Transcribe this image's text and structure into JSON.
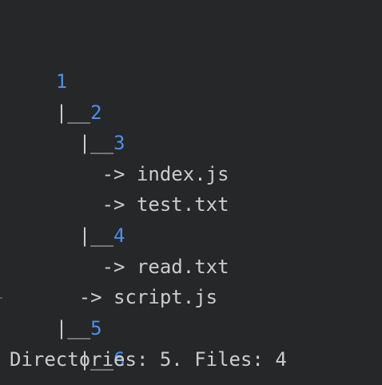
{
  "console": {
    "lines": [
      {
        "kind": "dir",
        "prefix": "",
        "text": "1"
      },
      {
        "kind": "dir",
        "prefix": "|__",
        "text": "2"
      },
      {
        "kind": "dir",
        "prefix": "  |__",
        "text": "3"
      },
      {
        "kind": "file",
        "prefix": "    -> ",
        "text": "index.js"
      },
      {
        "kind": "file",
        "prefix": "    -> ",
        "text": "test.txt"
      },
      {
        "kind": "dir",
        "prefix": "  |__",
        "text": "4"
      },
      {
        "kind": "file",
        "prefix": "    -> ",
        "text": "read.txt"
      },
      {
        "kind": "file",
        "prefix": "  -> ",
        "text": "script.js"
      },
      {
        "kind": "dir",
        "prefix": "|__",
        "text": "5"
      },
      {
        "kind": "dir",
        "prefix": "  |__",
        "text": "6"
      }
    ],
    "summary": "Directories: 5. Files: 4"
  },
  "colors": {
    "background": "#262728",
    "directory": "#4f8fe6",
    "text": "#cccccc"
  }
}
